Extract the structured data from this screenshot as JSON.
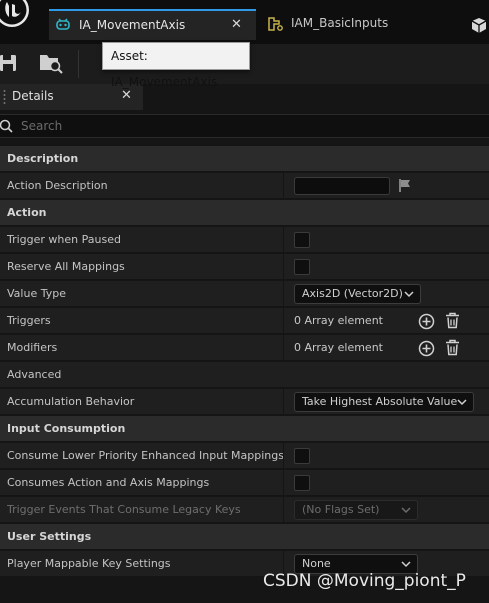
{
  "tabs": [
    {
      "label": "IA_MovementAxis",
      "active": true
    },
    {
      "label": "IAM_BasicInputs",
      "active": false
    }
  ],
  "tooltip": "Asset: IA_MovementAxis",
  "panel": {
    "title": "Details"
  },
  "search": {
    "placeholder": "Search"
  },
  "rows": {
    "description_cat": "Description",
    "action_description": "Action Description",
    "action_cat": "Action",
    "trigger_when_paused": "Trigger when Paused",
    "reserve_all_mappings": "Reserve All Mappings",
    "value_type": "Value Type",
    "value_type_value": "Axis2D (Vector2D)",
    "triggers": "Triggers",
    "triggers_value": "0 Array element",
    "modifiers": "Modifiers",
    "modifiers_value": "0 Array element",
    "advanced": "Advanced",
    "accumulation_behavior": "Accumulation Behavior",
    "accumulation_value": "Take Highest Absolute Value",
    "input_consumption_cat": "Input Consumption",
    "consume_lower": "Consume Lower Priority Enhanced Input Mappings",
    "consumes_action_axis": "Consumes Action and Axis Mappings",
    "trigger_events_legacy": "Trigger Events That Consume Legacy Keys",
    "trigger_events_value": "(No Flags Set)",
    "user_settings_cat": "User Settings",
    "player_mappable": "Player Mappable Key Settings",
    "player_mappable_value": "None"
  },
  "watermark": "CSDN @Moving_piont_P",
  "colors": {
    "accent": "#2f9be8",
    "background": "#151515",
    "row": "#1f1f1f",
    "category": "#2b2b2b"
  },
  "icons": [
    "unreal-logo-icon",
    "input-action-icon",
    "close-icon",
    "input-mapping-icon",
    "save-icon",
    "browse-icon",
    "grip-icon",
    "search-icon",
    "flag-icon",
    "add-icon",
    "delete-icon",
    "chevron-down-icon"
  ]
}
